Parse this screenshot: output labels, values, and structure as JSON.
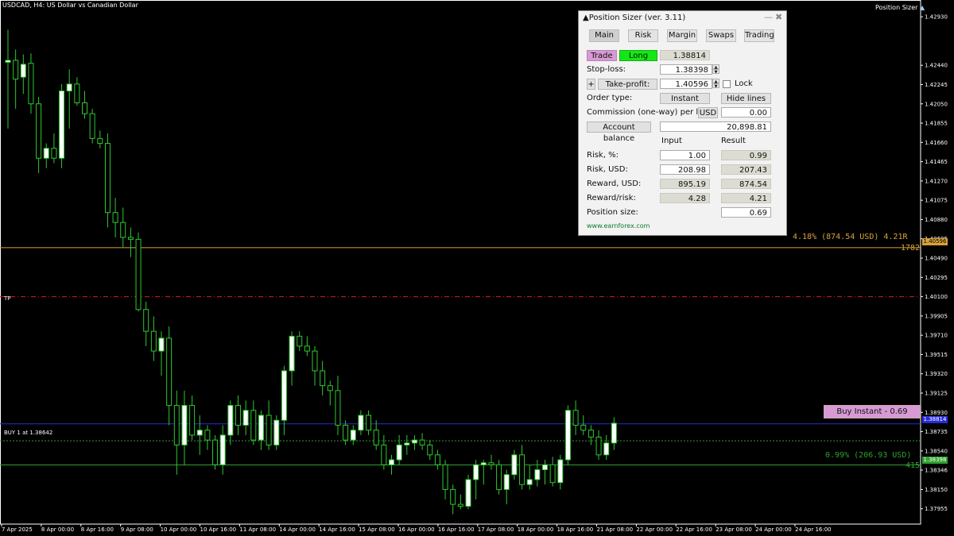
{
  "chart": {
    "symbol_title": "USDCAD, H4:  US Dollar vs Canadian Dollar",
    "ps_indicator_label": "Position Sizer",
    "price_ticks": [
      "1.42930",
      "1.42440",
      "1.42245",
      "1.42050",
      "1.41855",
      "1.41660",
      "1.41465",
      "1.41270",
      "1.41075",
      "1.40880",
      "1.40685",
      "1.40490",
      "1.40295",
      "1.40100",
      "1.39905",
      "1.39710",
      "1.39515",
      "1.39320",
      "1.39125",
      "1.38930",
      "1.38735",
      "1.38540",
      "1.38346",
      "1.38150",
      "1.37955"
    ],
    "price_tick_values": [
      1.4293,
      1.4244,
      1.42245,
      1.4205,
      1.41855,
      1.4166,
      1.41465,
      1.4127,
      1.41075,
      1.4088,
      1.40685,
      1.4049,
      1.40295,
      1.401,
      1.39905,
      1.3971,
      1.39515,
      1.3932,
      1.39125,
      1.3893,
      1.38735,
      1.3854,
      1.38346,
      1.3815,
      1.37955
    ],
    "date_ticks": [
      "7 Apr 2025",
      "8 Apr 00:00",
      "8 Apr 16:00",
      "9 Apr 08:00",
      "10 Apr 00:00",
      "10 Apr 16:00",
      "11 Apr 08:00",
      "14 Apr 00:00",
      "14 Apr 16:00",
      "15 Apr 08:00",
      "16 Apr 00:00",
      "16 Apr 16:00",
      "17 Apr 08:00",
      "18 Apr 00:00",
      "18 Apr 16:00",
      "21 Apr 08:00",
      "22 Apr 00:00",
      "22 Apr 16:00",
      "23 Apr 08:00",
      "24 Apr 00:00",
      "24 Apr 16:00"
    ],
    "tp_label": "TP",
    "tp_right_text": "4.18% (874.54 USD) 4.21R",
    "tp_points": "1782",
    "tp_price_box": "1.40596",
    "entry_label": "BUY 1 at 1.38642",
    "sl_right_text": "0.99% (206.93 USD)",
    "sl_points": "415",
    "sl_price_box": "1.38398",
    "current_price_box": "1.38814",
    "buy_instant_label": "Buy Instant - 0.69",
    "colors": {
      "tp": "#d8a13a",
      "sl": "#2fa02f",
      "entry": "#2b2bd6",
      "tp_dash": "#d02020",
      "bull": "#ffffff",
      "bear": "#2ec82e"
    }
  },
  "chart_data": {
    "type": "candlestick",
    "ylim": [
      1.378,
      1.431
    ],
    "candles": [
      [
        1.4247,
        1.428,
        1.418,
        1.4249
      ],
      [
        1.4249,
        1.426,
        1.42,
        1.423
      ],
      [
        1.4232,
        1.4255,
        1.4215,
        1.4245
      ],
      [
        1.4246,
        1.4256,
        1.4195,
        1.4205
      ],
      [
        1.4205,
        1.4212,
        1.4135,
        1.415
      ],
      [
        1.415,
        1.4165,
        1.414,
        1.416
      ],
      [
        1.416,
        1.4175,
        1.4145,
        1.415
      ],
      [
        1.415,
        1.4225,
        1.414,
        1.4218
      ],
      [
        1.4218,
        1.424,
        1.418,
        1.4225
      ],
      [
        1.4225,
        1.4232,
        1.4203,
        1.4206
      ],
      [
        1.4206,
        1.4218,
        1.419,
        1.4195
      ],
      [
        1.4195,
        1.42,
        1.4165,
        1.417
      ],
      [
        1.417,
        1.4178,
        1.416,
        1.4165
      ],
      [
        1.4165,
        1.4175,
        1.408,
        1.4095
      ],
      [
        1.4095,
        1.411,
        1.407,
        1.4085
      ],
      [
        1.4085,
        1.41,
        1.406,
        1.407
      ],
      [
        1.407,
        1.408,
        1.405,
        1.4068
      ],
      [
        1.4068,
        1.4075,
        1.3995,
        1.3997
      ],
      [
        1.3997,
        1.4005,
        1.396,
        1.3975
      ],
      [
        1.3975,
        1.399,
        1.3945,
        1.3955
      ],
      [
        1.3955,
        1.3975,
        1.393,
        1.3968
      ],
      [
        1.3968,
        1.398,
        1.388,
        1.39
      ],
      [
        1.39,
        1.3915,
        1.383,
        1.386
      ],
      [
        1.386,
        1.3915,
        1.384,
        1.39
      ],
      [
        1.39,
        1.391,
        1.3865,
        1.387
      ],
      [
        1.387,
        1.389,
        1.385,
        1.3875
      ],
      [
        1.3875,
        1.388,
        1.3855,
        1.3865
      ],
      [
        1.3865,
        1.387,
        1.3835,
        1.384
      ],
      [
        1.384,
        1.388,
        1.383,
        1.387
      ],
      [
        1.387,
        1.3905,
        1.386,
        1.39
      ],
      [
        1.39,
        1.391,
        1.387,
        1.388
      ],
      [
        1.388,
        1.3905,
        1.387,
        1.3895
      ],
      [
        1.3895,
        1.3905,
        1.386,
        1.3865
      ],
      [
        1.3865,
        1.3895,
        1.3855,
        1.389
      ],
      [
        1.389,
        1.3905,
        1.3855,
        1.386
      ],
      [
        1.386,
        1.389,
        1.3855,
        1.3885
      ],
      [
        1.3885,
        1.394,
        1.387,
        1.3935
      ],
      [
        1.3935,
        1.3975,
        1.392,
        1.397
      ],
      [
        1.397,
        1.3975,
        1.3955,
        1.396
      ],
      [
        1.396,
        1.397,
        1.395,
        1.3955
      ],
      [
        1.3955,
        1.396,
        1.392,
        1.3935
      ],
      [
        1.3935,
        1.3945,
        1.391,
        1.392
      ],
      [
        1.392,
        1.3925,
        1.39,
        1.3915
      ],
      [
        1.3915,
        1.393,
        1.387,
        1.388
      ],
      [
        1.388,
        1.3885,
        1.386,
        1.3865
      ],
      [
        1.3865,
        1.388,
        1.386,
        1.3875
      ],
      [
        1.3875,
        1.3895,
        1.387,
        1.389
      ],
      [
        1.389,
        1.3895,
        1.387,
        1.3875
      ],
      [
        1.3875,
        1.3885,
        1.3855,
        1.386
      ],
      [
        1.386,
        1.387,
        1.3835,
        1.384
      ],
      [
        1.384,
        1.385,
        1.383,
        1.3845
      ],
      [
        1.3845,
        1.387,
        1.384,
        1.386
      ],
      [
        1.386,
        1.387,
        1.385,
        1.3862
      ],
      [
        1.3862,
        1.387,
        1.3855,
        1.3865
      ],
      [
        1.3865,
        1.3872,
        1.3855,
        1.386
      ],
      [
        1.386,
        1.3865,
        1.3845,
        1.385
      ],
      [
        1.385,
        1.3855,
        1.3835,
        1.384
      ],
      [
        1.384,
        1.3845,
        1.3805,
        1.3815
      ],
      [
        1.3815,
        1.382,
        1.379,
        1.38
      ],
      [
        1.38,
        1.381,
        1.3795,
        1.3798
      ],
      [
        1.3798,
        1.383,
        1.3795,
        1.3825
      ],
      [
        1.3825,
        1.3845,
        1.3805,
        1.384
      ],
      [
        1.384,
        1.3845,
        1.382,
        1.3842
      ],
      [
        1.3842,
        1.385,
        1.3835,
        1.384
      ],
      [
        1.384,
        1.3845,
        1.381,
        1.3815
      ],
      [
        1.3815,
        1.3835,
        1.38,
        1.383
      ],
      [
        1.383,
        1.3855,
        1.3825,
        1.385
      ],
      [
        1.385,
        1.386,
        1.3815,
        1.382
      ],
      [
        1.382,
        1.384,
        1.3815,
        1.3825
      ],
      [
        1.3825,
        1.3845,
        1.3818,
        1.3835
      ],
      [
        1.3835,
        1.3845,
        1.382,
        1.384
      ],
      [
        1.384,
        1.3848,
        1.3818,
        1.3822
      ],
      [
        1.3822,
        1.385,
        1.3815,
        1.3845
      ],
      [
        1.3845,
        1.39,
        1.384,
        1.3895
      ],
      [
        1.3895,
        1.3905,
        1.387,
        1.388
      ],
      [
        1.388,
        1.389,
        1.387,
        1.3875
      ],
      [
        1.3875,
        1.388,
        1.386,
        1.3868
      ],
      [
        1.3868,
        1.3875,
        1.3845,
        1.385
      ],
      [
        1.385,
        1.387,
        1.3845,
        1.3862
      ],
      [
        1.3862,
        1.3888,
        1.3855,
        1.3882
      ]
    ]
  },
  "panel": {
    "title": "▲Position Sizer (ver. 3.11)",
    "min_glyph": "—",
    "close_glyph": "✖",
    "tabs": [
      "Main",
      "Risk",
      "Margin",
      "Swaps",
      "Trading"
    ],
    "trade_button": "Trade",
    "direction_button": "Long",
    "entry_value": "1.38814",
    "stop_loss_label": "Stop-loss:",
    "stop_loss_value": "1.38398",
    "plus_button": "+",
    "take_profit_button": "Take-profit:",
    "take_profit_value": "1.40596",
    "lock_label": "Lock",
    "order_type_label": "Order type:",
    "order_type_value": "Instant",
    "hide_lines_button": "Hide lines",
    "commission_label": "Commission (one-way) per lot:",
    "commission_currency": "USD",
    "commission_value": "0.00",
    "account_balance_button": "Account balance",
    "account_balance_value": "20,898.81",
    "col_input": "Input",
    "col_result": "Result",
    "risk_pct_label": "Risk, %:",
    "risk_pct_input": "1.00",
    "risk_pct_result": "0.99",
    "risk_usd_label": "Risk, USD:",
    "risk_usd_input": "208.98",
    "risk_usd_result": "207.43",
    "reward_usd_label": "Reward, USD:",
    "reward_usd_input": "895.19",
    "reward_usd_result": "874.54",
    "reward_risk_label": "Reward/risk:",
    "reward_risk_input": "4.28",
    "reward_risk_result": "4.21",
    "position_size_label": "Position size:",
    "position_size_value": "0.69",
    "website": "www.earnforex.com"
  }
}
